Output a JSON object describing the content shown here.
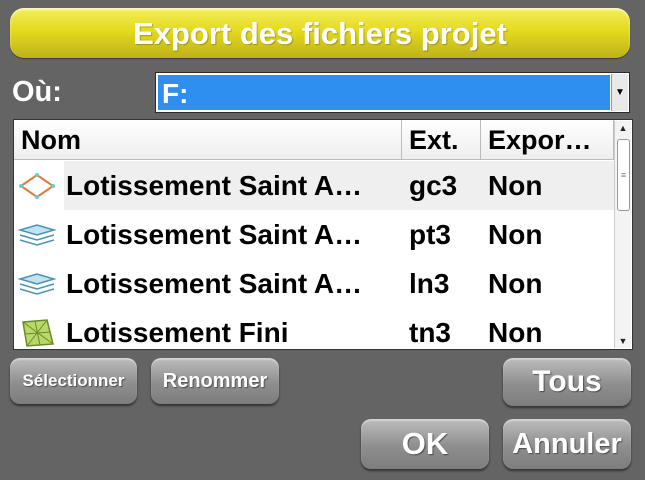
{
  "dialog": {
    "title": "Export des fichiers projet"
  },
  "where": {
    "label": "Où:",
    "value": "F:"
  },
  "list": {
    "columns": [
      "Nom",
      "Ext.",
      "Expor…"
    ],
    "rows": [
      {
        "icon": "diamond-outline-icon",
        "name": "Lotissement Saint A…",
        "ext": "gc3",
        "export": "Non",
        "selected": true
      },
      {
        "icon": "layers-icon",
        "name": "Lotissement Saint A…",
        "ext": "pt3",
        "export": "Non"
      },
      {
        "icon": "layers-icon",
        "name": "Lotissement Saint A…",
        "ext": "ln3",
        "export": "Non"
      },
      {
        "icon": "terrain-mesh-icon",
        "name": "Lotissement Fini",
        "ext": "tn3",
        "export": "Non"
      }
    ]
  },
  "buttons": {
    "select": "Sélectionner",
    "rename": "Renommer",
    "all": "Tous",
    "ok": "OK",
    "cancel": "Annuler"
  },
  "colors": {
    "title_bar": "#e4da1e",
    "selection_blue": "#2f8ff0",
    "background": "#646464"
  }
}
